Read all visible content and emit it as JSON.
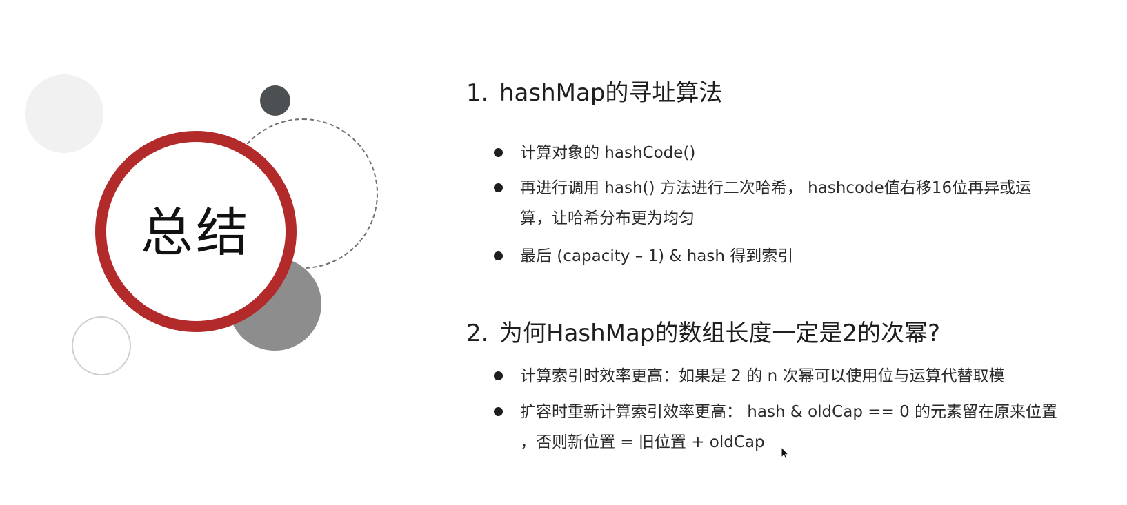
{
  "slide": {
    "ring_title": "总结",
    "sections": [
      {
        "number": "1.",
        "title": "hashMap的寻址算法",
        "bullets": [
          "计算对象的 hashCode()",
          "再进行调用 hash() 方法进行二次哈希， hashcode值右移16位再异或运算，让哈希分布更为均匀",
          "最后 (capacity – 1) & hash 得到索引"
        ]
      },
      {
        "number": "2.",
        "title": "为何HashMap的数组长度一定是2的次幂?",
        "bullets": [
          "计算索引时效率更高：如果是 2 的 n 次幂可以使用位与运算代替取模",
          "扩容时重新计算索引效率更高： hash & oldCap == 0 的元素留在原来位置 ，否则新位置 = 旧位置 + oldCap"
        ]
      }
    ]
  },
  "colors": {
    "ring": "#b32a2a",
    "dark_circle": "#4c5052",
    "gray_circle": "#8d8d8d",
    "light_circle": "#f1f1f1",
    "text": "#222222"
  },
  "icons": {
    "cursor": "mouse-pointer-icon",
    "bullet": "bullet-dot-icon"
  }
}
